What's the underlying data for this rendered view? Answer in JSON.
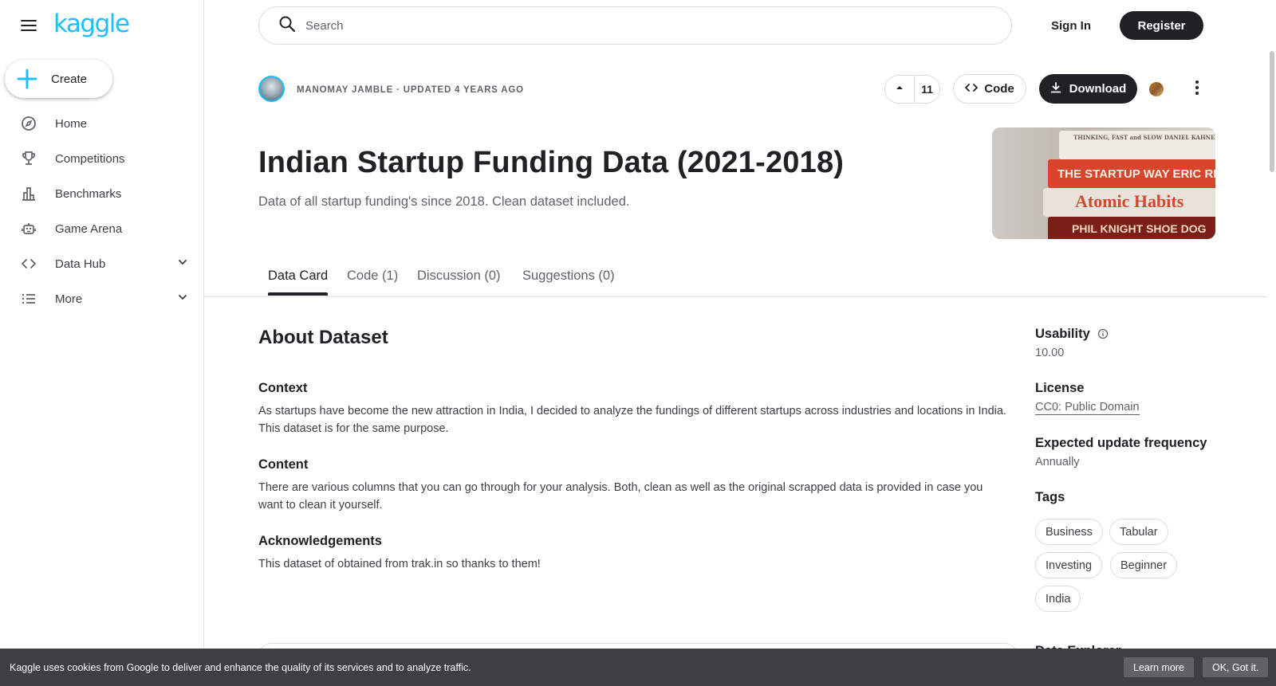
{
  "brand": {
    "logo_text": "kaggle",
    "accent": "#20beff"
  },
  "sidebar": {
    "create_label": "Create",
    "items": [
      {
        "label": "Home",
        "icon": "compass-icon"
      },
      {
        "label": "Competitions",
        "icon": "trophy-icon"
      },
      {
        "label": "Benchmarks",
        "icon": "bar-chart-icon"
      },
      {
        "label": "Game Arena",
        "icon": "robot-icon"
      },
      {
        "label": "Data Hub",
        "icon": "code-brackets-icon",
        "expandable": true
      },
      {
        "label": "More",
        "icon": "list-icon",
        "expandable": true
      }
    ]
  },
  "topbar": {
    "search_placeholder": "Search",
    "signin_label": "Sign In",
    "register_label": "Register"
  },
  "dataset": {
    "author_line": "MANOMAY JAMBLE · UPDATED 4 YEARS AGO",
    "upvotes": "11",
    "code_label": "Code",
    "download_label": "Download",
    "title": "Indian Startup Funding Data (2021-2018)",
    "subtitle": "Data of all startup funding's since 2018. Clean dataset included.",
    "cover_text": {
      "book1": "THINKING, FAST and SLOW   DANIEL KAHNEMAN",
      "book2": "THE STARTUP WAY   ERIC RIES",
      "book3": "Atomic Habits",
      "book4": "PHIL KNIGHT  SHOE DOG"
    }
  },
  "tabs": [
    {
      "label": "Data Card",
      "active": true
    },
    {
      "label": "Code (1)",
      "active": false
    },
    {
      "label": "Discussion (0)",
      "active": false
    },
    {
      "label": "Suggestions (0)",
      "active": false
    }
  ],
  "about": {
    "heading": "About Dataset",
    "sections": [
      {
        "heading": "Context",
        "text": "As startups have become the new attraction in India, I decided to analyze the fundings of different startups across industries and locations in India. This dataset is for the same purpose."
      },
      {
        "heading": "Content",
        "text": "There are various columns that you can go through for your analysis. Both, clean as well as the original scrapped data is provided in case you want to clean it yourself."
      },
      {
        "heading": "Acknowledgements",
        "text": "This dataset of obtained from trak.in so thanks to them!"
      }
    ]
  },
  "meta": {
    "usability_label": "Usability",
    "usability_value": "10.00",
    "license_label": "License",
    "license_value": "CC0: Public Domain",
    "frequency_label": "Expected update frequency",
    "frequency_value": "Annually",
    "tags_label": "Tags",
    "tags": [
      "Business",
      "Tabular",
      "Investing",
      "Beginner",
      "India"
    ],
    "partial_heading": "Data Explorer"
  },
  "cookie": {
    "message": "Kaggle uses cookies from Google to deliver and enhance the quality of its services and to analyze traffic.",
    "learn_more": "Learn more",
    "ok": "OK, Got it."
  }
}
